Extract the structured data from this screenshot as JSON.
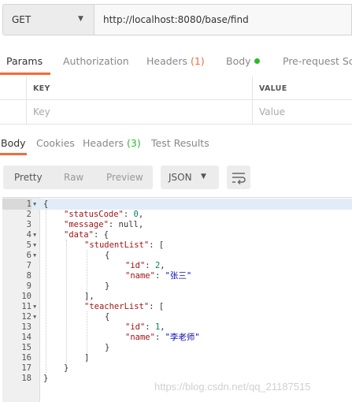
{
  "request": {
    "method": "GET",
    "url": "http://localhost:8080/base/find"
  },
  "request_tabs": [
    {
      "label": "Params",
      "active": true
    },
    {
      "label": "Authorization"
    },
    {
      "label": "Headers",
      "count": "(1)"
    },
    {
      "label": "Body"
    },
    {
      "label": "Pre-request Scri"
    }
  ],
  "params_table": {
    "headers": [
      "KEY",
      "VALUE"
    ],
    "key_placeholder": "Key",
    "value_placeholder": "Value"
  },
  "response_tabs": [
    {
      "label": "Body",
      "active": true
    },
    {
      "label": "Cookies"
    },
    {
      "label": "Headers",
      "count": "(3)"
    },
    {
      "label": "Test Results"
    }
  ],
  "format_buttons": [
    {
      "label": "Pretty",
      "active": true
    },
    {
      "label": "Raw"
    },
    {
      "label": "Preview"
    }
  ],
  "format_select": "JSON",
  "icons": {
    "method_caret": "chevron-down-icon",
    "format_caret": "chevron-down-icon",
    "wrap": "wrap-lines-icon",
    "fold": "fold-arrow-icon"
  },
  "colors": {
    "accent": "#f26b3a",
    "status_green": "#2eb82e",
    "json_key": "#a31515",
    "json_string": "#0b0bb0",
    "json_number": "#098658"
  },
  "response_body": [
    {
      "n": "1",
      "fold": true,
      "indent": 0,
      "tokens": [
        [
          "p",
          "{"
        ]
      ]
    },
    {
      "n": "2",
      "indent": 1,
      "tokens": [
        [
          "k",
          "\"statusCode\""
        ],
        [
          "p",
          ": "
        ],
        [
          "n",
          "0"
        ],
        [
          "p",
          ","
        ]
      ]
    },
    {
      "n": "3",
      "indent": 1,
      "tokens": [
        [
          "k",
          "\"message\""
        ],
        [
          "p",
          ": null,"
        ]
      ]
    },
    {
      "n": "4",
      "fold": true,
      "indent": 1,
      "tokens": [
        [
          "k",
          "\"data\""
        ],
        [
          "p",
          ": {"
        ]
      ]
    },
    {
      "n": "5",
      "fold": true,
      "indent": 2,
      "tokens": [
        [
          "k",
          "\"studentList\""
        ],
        [
          "p",
          ": ["
        ]
      ]
    },
    {
      "n": "6",
      "fold": true,
      "indent": 3,
      "tokens": [
        [
          "p",
          "{"
        ]
      ]
    },
    {
      "n": "7",
      "indent": 4,
      "tokens": [
        [
          "k",
          "\"id\""
        ],
        [
          "p",
          ": "
        ],
        [
          "n",
          "2"
        ],
        [
          "p",
          ","
        ]
      ]
    },
    {
      "n": "8",
      "indent": 4,
      "tokens": [
        [
          "k",
          "\"name\""
        ],
        [
          "p",
          ": "
        ],
        [
          "s",
          "\"张三\""
        ]
      ]
    },
    {
      "n": "9",
      "indent": 3,
      "tokens": [
        [
          "p",
          "}"
        ]
      ]
    },
    {
      "n": "10",
      "indent": 2,
      "tokens": [
        [
          "p",
          "],"
        ]
      ]
    },
    {
      "n": "11",
      "fold": true,
      "indent": 2,
      "tokens": [
        [
          "k",
          "\"teacherList\""
        ],
        [
          "p",
          ": ["
        ]
      ]
    },
    {
      "n": "12",
      "fold": true,
      "indent": 3,
      "tokens": [
        [
          "p",
          "{"
        ]
      ]
    },
    {
      "n": "13",
      "indent": 4,
      "tokens": [
        [
          "k",
          "\"id\""
        ],
        [
          "p",
          ": "
        ],
        [
          "n",
          "1"
        ],
        [
          "p",
          ","
        ]
      ]
    },
    {
      "n": "14",
      "indent": 4,
      "tokens": [
        [
          "k",
          "\"name\""
        ],
        [
          "p",
          ": "
        ],
        [
          "s",
          "\"李老师\""
        ]
      ]
    },
    {
      "n": "15",
      "indent": 3,
      "tokens": [
        [
          "p",
          "}"
        ]
      ]
    },
    {
      "n": "16",
      "indent": 2,
      "tokens": [
        [
          "p",
          "]"
        ]
      ]
    },
    {
      "n": "17",
      "indent": 1,
      "tokens": [
        [
          "p",
          "}"
        ]
      ]
    },
    {
      "n": "18",
      "indent": 0,
      "tokens": [
        [
          "p",
          "}"
        ]
      ]
    }
  ],
  "watermark": "https://blog.csdn.net/qq_21187515"
}
